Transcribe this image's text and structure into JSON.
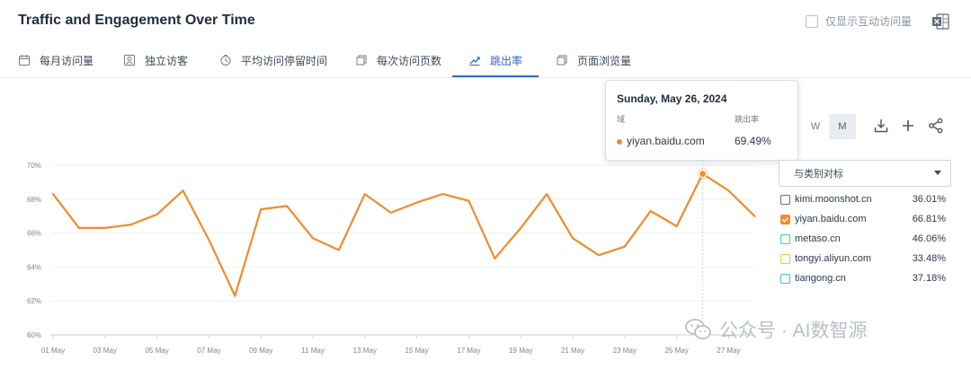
{
  "header": {
    "title": "Traffic and Engagement Over Time",
    "only_interactive_label": "仅显示互动访问量"
  },
  "tabs": [
    {
      "label": "每月访问量",
      "icon": "calendar-icon"
    },
    {
      "label": "独立访客",
      "icon": "user-icon"
    },
    {
      "label": "平均访问停留时间",
      "icon": "clock-icon"
    },
    {
      "label": "每次访问页数",
      "icon": "pages-icon"
    },
    {
      "label": "跳出率",
      "icon": "bounce-icon",
      "active": true
    },
    {
      "label": "页面浏览量",
      "icon": "views-icon"
    }
  ],
  "tooltip": {
    "date": "Sunday, May 26, 2024",
    "col_domain": "域",
    "col_metric": "跳出率",
    "domain": "yiyan.baidu.com",
    "value": "69.49%"
  },
  "controls": {
    "period_options": [
      "W",
      "M"
    ],
    "selected_period": "M",
    "compare_label": "与类别对标"
  },
  "legend": [
    {
      "name": "kimi.moonshot.cn",
      "value": "36.01%",
      "color": "#5c6f8f",
      "checked": false
    },
    {
      "name": "yiyan.baidu.com",
      "value": "66.81%",
      "color": "#f28c28",
      "checked": true
    },
    {
      "name": "metaso.cn",
      "value": "46.06%",
      "color": "#3ccf9f",
      "checked": false
    },
    {
      "name": "tongyi.aliyun.com",
      "value": "33.48%",
      "color": "#f5c533",
      "checked": false
    },
    {
      "name": "tiangong.cn",
      "value": "37.18%",
      "color": "#37c6d0",
      "checked": false
    }
  ],
  "watermark": "公众号 · AI数智源",
  "chart_data": {
    "type": "line",
    "x_ticks": [
      "01 May",
      "03 May",
      "05 May",
      "07 May",
      "09 May",
      "11 May",
      "13 May",
      "15 May",
      "17 May",
      "19 May",
      "21 May",
      "23 May",
      "25 May",
      "27 May"
    ],
    "y_ticks": [
      "60%",
      "62%",
      "64%",
      "66%",
      "68%",
      "70%"
    ],
    "ylim": [
      60,
      70
    ],
    "series": [
      {
        "name": "yiyan.baidu.com",
        "color": "#f28c28",
        "x": [
          "01 May",
          "02 May",
          "03 May",
          "04 May",
          "05 May",
          "06 May",
          "07 May",
          "08 May",
          "09 May",
          "10 May",
          "11 May",
          "12 May",
          "13 May",
          "14 May",
          "15 May",
          "16 May",
          "17 May",
          "18 May",
          "19 May",
          "20 May",
          "21 May",
          "22 May",
          "23 May",
          "24 May",
          "25 May",
          "26 May",
          "27 May",
          "28 May"
        ],
        "values": [
          68.3,
          66.3,
          66.3,
          66.5,
          67.1,
          68.5,
          65.6,
          62.3,
          67.4,
          67.6,
          65.7,
          65.0,
          68.3,
          67.2,
          67.8,
          68.3,
          67.9,
          64.5,
          66.3,
          68.3,
          65.7,
          64.7,
          65.2,
          67.3,
          66.4,
          69.49,
          68.5,
          67.0
        ]
      }
    ],
    "highlight": {
      "x": "26 May",
      "value": 69.49
    }
  }
}
